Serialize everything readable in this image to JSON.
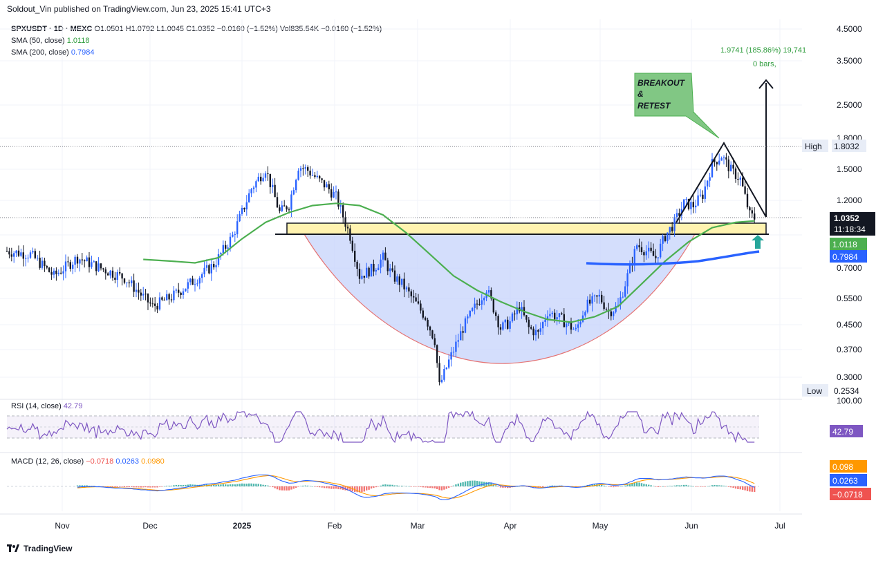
{
  "publish_line": "Soldout_Vin published on TradingView.com, Jun 23, 2025 15:41 UTC+3",
  "legend": {
    "symbol": "SPXUSDT · 1D · MEXC",
    "ohlc": "O1.0501  H1.0792  L1.0045  C1.0352  −0.0160 (−1.52%)  Vol835.54K  −0.0160 (−1.52%)",
    "sma50_label": "SMA (50, close)",
    "sma50_value": "1.0118",
    "sma200_label": "SMA (200, close)",
    "sma200_value": "0.7984"
  },
  "rsi_legend": {
    "label": "RSI (14, close)",
    "value": "42.79"
  },
  "macd_legend": {
    "label": "MACD (12, 26, close)",
    "macd": "−0.0718",
    "signal": "0.0263",
    "hist": "0.0980"
  },
  "footer": {
    "brand": "TradingView"
  },
  "colors": {
    "up": "#2962ff",
    "down": "#131722",
    "sma50": "#4caf50",
    "sma200": "#2962ff",
    "rsi": "#7e57c2",
    "macd_line": "#2962ff",
    "signal_line": "#ff9800",
    "hist_up": "#26a69a",
    "hist_down": "#ef5350",
    "cup_fill": "#c5d3fb",
    "zone_fill": "#fff3b0"
  },
  "chart_data": {
    "type": "candlestick",
    "symbol": "SPXUSDT",
    "timeframe": "1D",
    "exchange": "MEXC",
    "y_scale": "log",
    "ylim": [
      0.25,
      4.5
    ],
    "price_ticks": [
      "4.5000",
      "3.5000",
      "2.5000",
      "1.8000",
      "1.5000",
      "1.2000",
      "0.7000",
      "0.5500",
      "0.4500",
      "0.3700",
      "0.3000",
      "100.00"
    ],
    "x_ticks": [
      "Nov",
      "Dec",
      "2025",
      "Feb",
      "Mar",
      "Apr",
      "May",
      "Jun",
      "Jul"
    ],
    "last_price": "1.0352",
    "countdown": "11:18:34",
    "sma50_last": "1.0118",
    "sma200_last": "0.7984",
    "high": {
      "label": "High",
      "value": "1.8032"
    },
    "low": {
      "label": "Low",
      "value": "0.2534"
    },
    "measure": {
      "text": "1.9741 (185.86%) 19,741",
      "bars": "0 bars,"
    },
    "annotation": "BREAKOUT & RETEST",
    "anchors_close": [
      [
        0,
        0.8
      ],
      [
        10,
        0.78
      ],
      [
        20,
        0.66
      ],
      [
        30,
        0.76
      ],
      [
        40,
        0.7
      ],
      [
        50,
        0.65
      ],
      [
        62,
        0.52
      ],
      [
        70,
        0.56
      ],
      [
        80,
        0.64
      ],
      [
        88,
        0.72
      ],
      [
        96,
        0.9
      ],
      [
        104,
        1.3
      ],
      [
        110,
        1.52
      ],
      [
        116,
        1.08
      ],
      [
        120,
        1.15
      ],
      [
        124,
        1.55
      ],
      [
        128,
        1.5
      ],
      [
        132,
        1.4
      ],
      [
        136,
        1.32
      ],
      [
        140,
        1.22
      ],
      [
        146,
        0.9
      ],
      [
        150,
        0.66
      ],
      [
        156,
        0.7
      ],
      [
        160,
        0.76
      ],
      [
        164,
        0.66
      ],
      [
        168,
        0.62
      ],
      [
        172,
        0.56
      ],
      [
        178,
        0.48
      ],
      [
        182,
        0.4
      ],
      [
        184,
        0.28
      ],
      [
        188,
        0.34
      ],
      [
        194,
        0.44
      ],
      [
        198,
        0.5
      ],
      [
        204,
        0.6
      ],
      [
        210,
        0.44
      ],
      [
        214,
        0.46
      ],
      [
        218,
        0.52
      ],
      [
        222,
        0.44
      ],
      [
        226,
        0.42
      ],
      [
        230,
        0.5
      ],
      [
        236,
        0.47
      ],
      [
        242,
        0.43
      ],
      [
        246,
        0.52
      ],
      [
        252,
        0.56
      ],
      [
        256,
        0.5
      ],
      [
        260,
        0.52
      ],
      [
        264,
        0.66
      ],
      [
        268,
        0.84
      ],
      [
        272,
        0.8
      ],
      [
        276,
        0.76
      ],
      [
        280,
        0.9
      ],
      [
        284,
        1.0
      ],
      [
        288,
        1.16
      ],
      [
        292,
        1.14
      ],
      [
        296,
        1.24
      ],
      [
        300,
        1.58
      ],
      [
        304,
        1.68
      ],
      [
        308,
        1.5
      ],
      [
        312,
        1.4
      ],
      [
        316,
        1.06
      ],
      [
        318,
        1.035
      ]
    ],
    "sma50_anchors": [
      [
        58,
        0.75
      ],
      [
        70,
        0.74
      ],
      [
        80,
        0.73
      ],
      [
        90,
        0.76
      ],
      [
        100,
        0.88
      ],
      [
        110,
        1.0
      ],
      [
        120,
        1.08
      ],
      [
        130,
        1.14
      ],
      [
        140,
        1.16
      ],
      [
        150,
        1.14
      ],
      [
        160,
        1.06
      ],
      [
        170,
        0.92
      ],
      [
        180,
        0.78
      ],
      [
        190,
        0.66
      ],
      [
        200,
        0.59
      ],
      [
        210,
        0.54
      ],
      [
        220,
        0.5
      ],
      [
        230,
        0.47
      ],
      [
        240,
        0.46
      ],
      [
        250,
        0.48
      ],
      [
        260,
        0.52
      ],
      [
        270,
        0.62
      ],
      [
        280,
        0.74
      ],
      [
        290,
        0.86
      ],
      [
        300,
        0.96
      ],
      [
        310,
        1.0
      ],
      [
        318,
        1.0118
      ]
    ],
    "sma200_anchors": [
      [
        250,
        0.79
      ],
      [
        262,
        0.79
      ],
      [
        272,
        0.785
      ],
      [
        282,
        0.78
      ],
      [
        292,
        0.78
      ],
      [
        302,
        0.785
      ],
      [
        312,
        0.79
      ],
      [
        318,
        0.7984
      ]
    ],
    "rsi_last": 42.79,
    "macd_last": -0.0718,
    "signal_last": 0.0263,
    "hist_last": 0.098
  }
}
